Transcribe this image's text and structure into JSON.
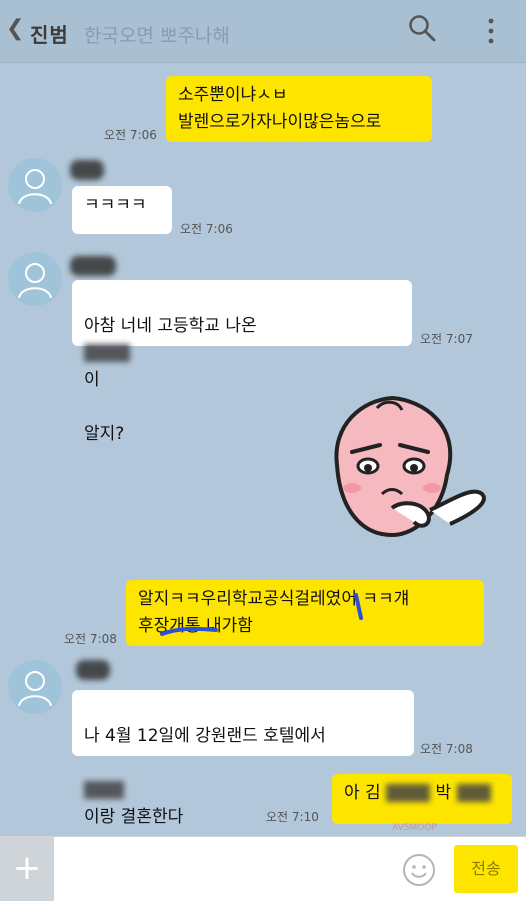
{
  "header": {
    "title": "진범",
    "subtitle": "한국오면 뽀주나해"
  },
  "messages": [
    {
      "text": "소주뿐이냐ㅅㅂ\n발렌으로가자나이많은놈으로",
      "time": "오전 7:06"
    },
    {
      "text": "ㅋㅋㅋㅋ",
      "time": "오전 7:06"
    },
    {
      "text_a": "아참 너네 고등학교 나온",
      "text_b": "이",
      "text_c": "알지?",
      "time": "오전 7:07"
    },
    {
      "text": "알지ㅋㅋ우리학교공식걸레였어 ㅋㅋ걔\n후장개통 내가함",
      "time": "오전 7:08"
    },
    {
      "text_a": "나 4월 12일에 강원랜드 호텔에서",
      "text_b": "이랑 결혼한다",
      "time": "오전 7:08"
    },
    {
      "text_a": "아 김",
      "text_b": "박",
      "time": "오전 7:10"
    }
  ],
  "input": {
    "placeholder": "",
    "send_label": "전송",
    "plus_label": "+"
  },
  "watermark": "AVSMOOP"
}
